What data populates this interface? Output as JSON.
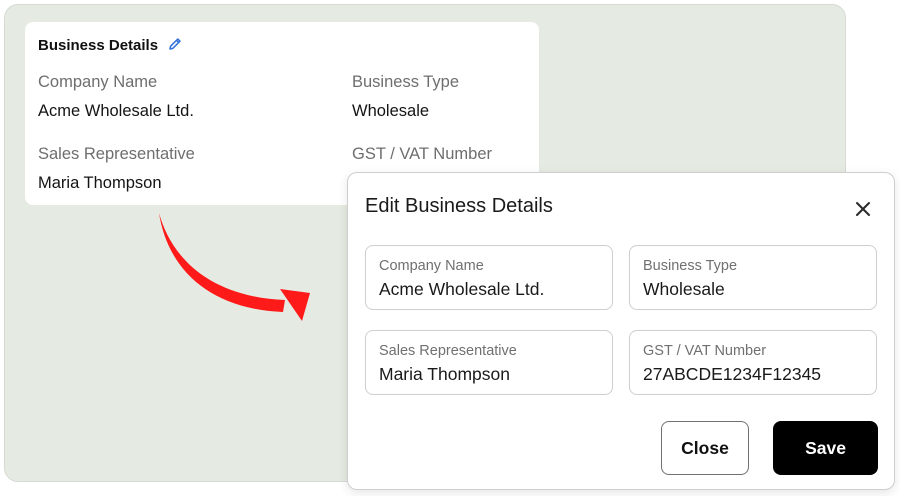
{
  "summary": {
    "title": "Business Details",
    "fields": [
      {
        "label": "Company Name",
        "value": "Acme Wholesale Ltd."
      },
      {
        "label": "Business Type",
        "value": "Wholesale"
      },
      {
        "label": "Sales Representative",
        "value": "Maria Thompson"
      },
      {
        "label": "GST / VAT Number",
        "value": ""
      }
    ]
  },
  "modal": {
    "title": "Edit Business Details",
    "fields": [
      {
        "label": "Company Name",
        "value": "Acme Wholesale Ltd."
      },
      {
        "label": "Business Type",
        "value": "Wholesale"
      },
      {
        "label": "Sales Representative",
        "value": "Maria Thompson"
      },
      {
        "label": "GST / VAT Number",
        "value": "27ABCDE1234F12345"
      }
    ],
    "close_label": "Close",
    "save_label": "Save"
  },
  "icons": {
    "edit": "pencil-icon",
    "dismiss": "close-icon",
    "transition": "curved-arrow-icon"
  },
  "colors": {
    "backdrop": "#e5ebe2",
    "edit_icon": "#2f6fd6",
    "arrow": "#ff1a1a",
    "save_button": "#000000"
  }
}
